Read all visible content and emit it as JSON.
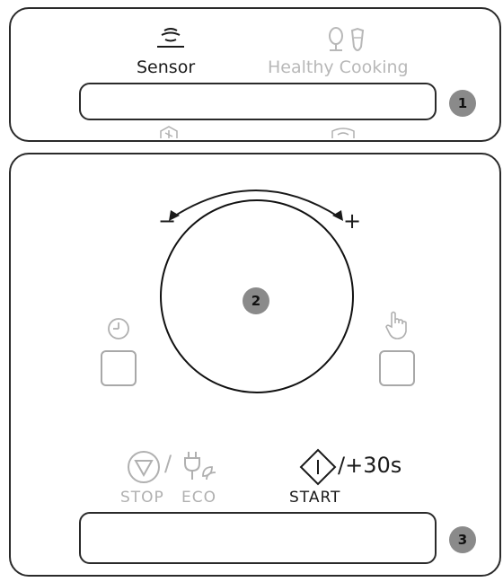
{
  "colors": {
    "outline": "#2a2a2a",
    "disabled": "#b0b0b0",
    "badge": "#8a8a8a"
  },
  "top_panel": {
    "sensor_label": "Sensor",
    "healthy_label": "Healthy Cooking",
    "callout": "1",
    "icons": [
      "sensor-waves-icon",
      "healthy-cooking-icon",
      "snowflake-defrost-icon",
      "steam-dish-icon"
    ]
  },
  "dial": {
    "minus": "−",
    "plus": "+",
    "callout": "2"
  },
  "side_buttons": {
    "left_icon": "clock-icon",
    "right_icon": "hand-pointer-icon"
  },
  "bottom_panel": {
    "stop_label": "STOP",
    "eco_label": "ECO",
    "slash": "/",
    "start_label": "START",
    "start_extra": "/+30s",
    "callout": "3"
  }
}
